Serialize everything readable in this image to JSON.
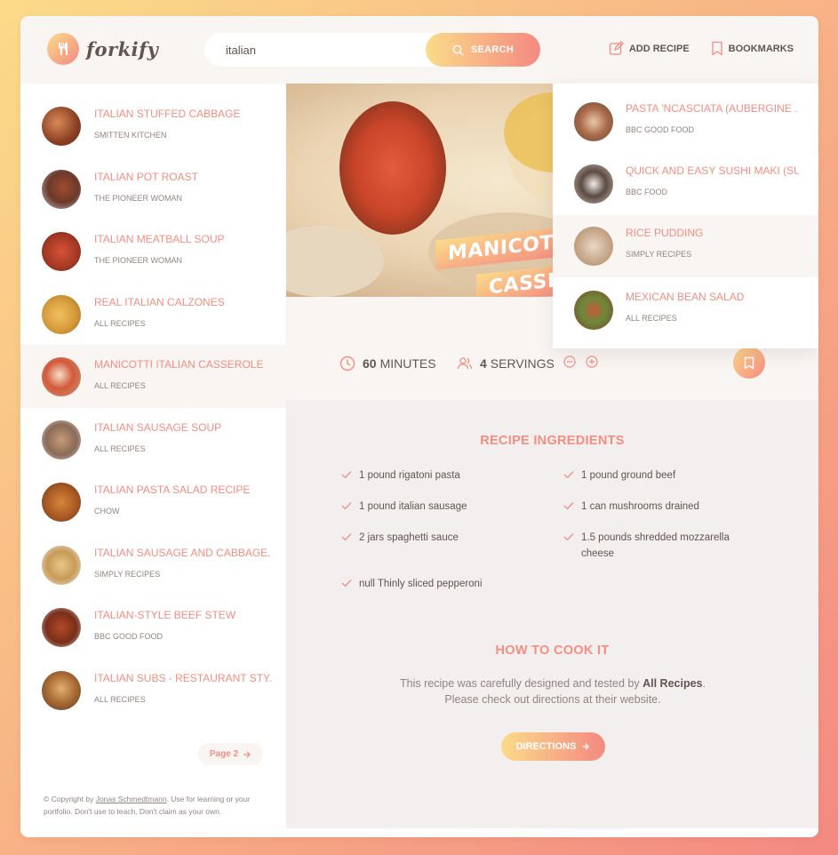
{
  "header": {
    "logo_text": "forkify",
    "search_value": "italian",
    "search_button": "SEARCH",
    "add_recipe": "ADD RECIPE",
    "bookmarks": "BOOKMARKS"
  },
  "results": [
    {
      "title": "ITALIAN STUFFED CABBAGE",
      "publisher": "SMITTEN KITCHEN"
    },
    {
      "title": "ITALIAN POT ROAST",
      "publisher": "THE PIONEER WOMAN"
    },
    {
      "title": "ITALIAN MEATBALL SOUP",
      "publisher": "THE PIONEER WOMAN"
    },
    {
      "title": "REAL ITALIAN CALZONES",
      "publisher": "ALL RECIPES"
    },
    {
      "title": "MANICOTTI ITALIAN CASSEROLE",
      "publisher": "ALL RECIPES"
    },
    {
      "title": "ITALIAN SAUSAGE SOUP",
      "publisher": "ALL RECIPES"
    },
    {
      "title": "ITALIAN PASTA SALAD RECIPE",
      "publisher": "CHOW"
    },
    {
      "title": "ITALIAN SAUSAGE AND CABBAGE...",
      "publisher": "SIMPLY RECIPES"
    },
    {
      "title": "ITALIAN-STYLE BEEF STEW",
      "publisher": "BBC GOOD FOOD"
    },
    {
      "title": "ITALIAN SUBS - RESTAURANT STY...",
      "publisher": "ALL RECIPES"
    }
  ],
  "pagination": {
    "next": "Page 2"
  },
  "copyright": {
    "prefix": "© Copyright by ",
    "author": "Jonas Schmedtmann",
    "suffix": ". Use for learning or your portfolio. Don't use to teach. Don't claim as your own."
  },
  "recipe": {
    "title_line1": "MANICOTT",
    "title_line2": "CASSE",
    "minutes": "60",
    "minutes_label": "MINUTES",
    "servings": "4",
    "servings_label": "SERVINGS",
    "ingredients_heading": "RECIPE INGREDIENTS",
    "ingredients": [
      "1 pound rigatoni pasta",
      "1 pound ground beef",
      "1 pound italian sausage",
      "1 can mushrooms drained",
      "2 jars spaghetti sauce",
      "1.5 pounds shredded mozzarella cheese",
      "null Thinly sliced pepperoni"
    ],
    "cook_heading": "HOW TO COOK IT",
    "cook_text_1": "This recipe was carefully designed and tested by ",
    "cook_publisher": "All Recipes",
    "cook_text_2": ". Please check out directions at their website.",
    "directions_button": "DIRECTIONS"
  },
  "bookmarks_list": [
    {
      "title": "PASTA 'NCASCIATA (AUBERGINE ...",
      "publisher": "BBC GOOD FOOD"
    },
    {
      "title": "QUICK AND EASY SUSHI MAKI (SU...",
      "publisher": "BBC FOOD"
    },
    {
      "title": "RICE PUDDING",
      "publisher": "SIMPLY RECIPES"
    },
    {
      "title": "MEXICAN BEAN SALAD",
      "publisher": "ALL RECIPES"
    }
  ],
  "colors": {
    "accent": "#f38e82",
    "gradient_start": "#fbdb89",
    "gradient_end": "#f48982",
    "text": "#615551"
  }
}
